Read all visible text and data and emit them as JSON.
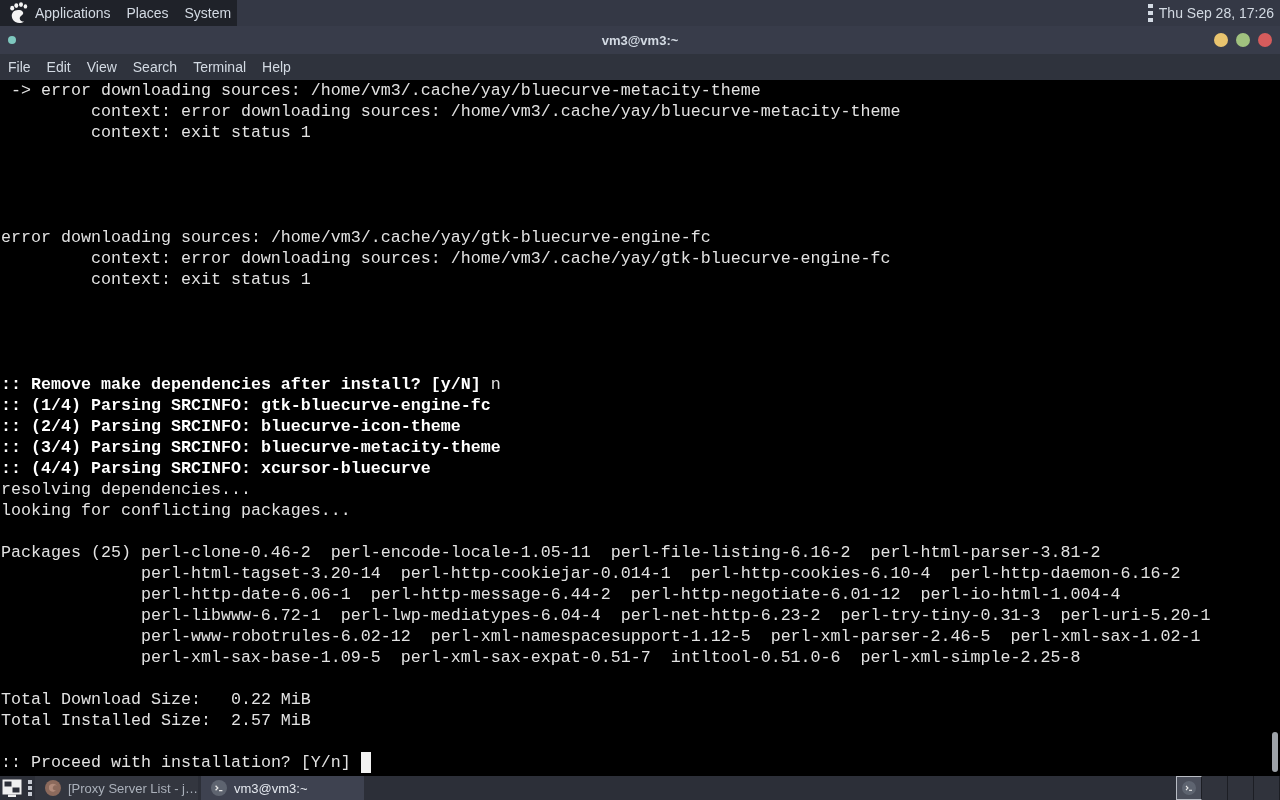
{
  "top_panel": {
    "menus": [
      "Applications",
      "Places",
      "System"
    ],
    "clock": "Thu Sep 28, 17:26"
  },
  "window": {
    "title": "vm3@vm3:~",
    "menu": [
      "File",
      "Edit",
      "View",
      "Search",
      "Terminal",
      "Help"
    ]
  },
  "terminal": {
    "lines": [
      {
        "kind": "sub",
        "text": "-> error downloading sources: /home/vm3/.cache/yay/bluecurve-metacity-theme"
      },
      {
        "kind": "context",
        "text": "context: error downloading sources: /home/vm3/.cache/yay/bluecurve-metacity-theme"
      },
      {
        "kind": "context",
        "text": "context: exit status 1"
      },
      {
        "kind": "blank"
      },
      {
        "kind": "blank"
      },
      {
        "kind": "blank"
      },
      {
        "kind": "blank"
      },
      {
        "kind": "plain",
        "text": "error downloading sources: /home/vm3/.cache/yay/gtk-bluecurve-engine-fc"
      },
      {
        "kind": "context",
        "text": "context: error downloading sources: /home/vm3/.cache/yay/gtk-bluecurve-engine-fc"
      },
      {
        "kind": "context",
        "text": "context: exit status 1"
      },
      {
        "kind": "blank"
      },
      {
        "kind": "blank"
      },
      {
        "kind": "blank"
      },
      {
        "kind": "blank"
      },
      {
        "kind": "plain",
        "text": "**:: Remove make dependencies after install? [y/N]** n"
      },
      {
        "kind": "bold",
        "text": ":: (1/4) Parsing SRCINFO: gtk-bluecurve-engine-fc"
      },
      {
        "kind": "bold",
        "text": ":: (2/4) Parsing SRCINFO: bluecurve-icon-theme"
      },
      {
        "kind": "bold",
        "text": ":: (3/4) Parsing SRCINFO: bluecurve-metacity-theme"
      },
      {
        "kind": "bold",
        "text": ":: (4/4) Parsing SRCINFO: xcursor-bluecurve"
      },
      {
        "kind": "plain",
        "text": "resolving dependencies..."
      },
      {
        "kind": "plain",
        "text": "looking for conflicting packages..."
      },
      {
        "kind": "blank"
      },
      {
        "kind": "packages",
        "label": "Packages (25)",
        "rows": [
          "perl-clone-0.46-2  perl-encode-locale-1.05-11  perl-file-listing-6.16-2  perl-html-parser-3.81-2",
          "perl-html-tagset-3.20-14  perl-http-cookiejar-0.014-1  perl-http-cookies-6.10-4  perl-http-daemon-6.16-2",
          "perl-http-date-6.06-1  perl-http-message-6.44-2  perl-http-negotiate-6.01-12  perl-io-html-1.004-4",
          "perl-libwww-6.72-1  perl-lwp-mediatypes-6.04-4  perl-net-http-6.23-2  perl-try-tiny-0.31-3  perl-uri-5.20-1",
          "perl-www-robotrules-6.02-12  perl-xml-namespacesupport-1.12-5  perl-xml-parser-2.46-5  perl-xml-sax-1.02-1",
          "perl-xml-sax-base-1.09-5  perl-xml-sax-expat-0.51-7  intltool-0.51.0-6  perl-xml-simple-2.25-8"
        ]
      },
      {
        "kind": "blank"
      },
      {
        "kind": "plain",
        "text": "Total Download Size:   0.22 MiB"
      },
      {
        "kind": "plain",
        "text": "Total Installed Size:  2.57 MiB"
      },
      {
        "kind": "blank"
      },
      {
        "kind": "input",
        "text": ":: Proceed with installation? [Y/n]",
        "cursor": true
      }
    ]
  },
  "taskbar": {
    "tasks": [
      {
        "kind": "browser",
        "title": "[Proxy Server List - j…",
        "selected": false
      },
      {
        "kind": "terminal",
        "title": "vm3@vm3:~",
        "selected": true
      }
    ],
    "workspaces": [
      {
        "kind": "terminal",
        "selected": true
      },
      {
        "kind": "empty",
        "selected": false
      },
      {
        "kind": "empty",
        "selected": false
      },
      {
        "kind": "empty",
        "selected": false
      }
    ]
  }
}
